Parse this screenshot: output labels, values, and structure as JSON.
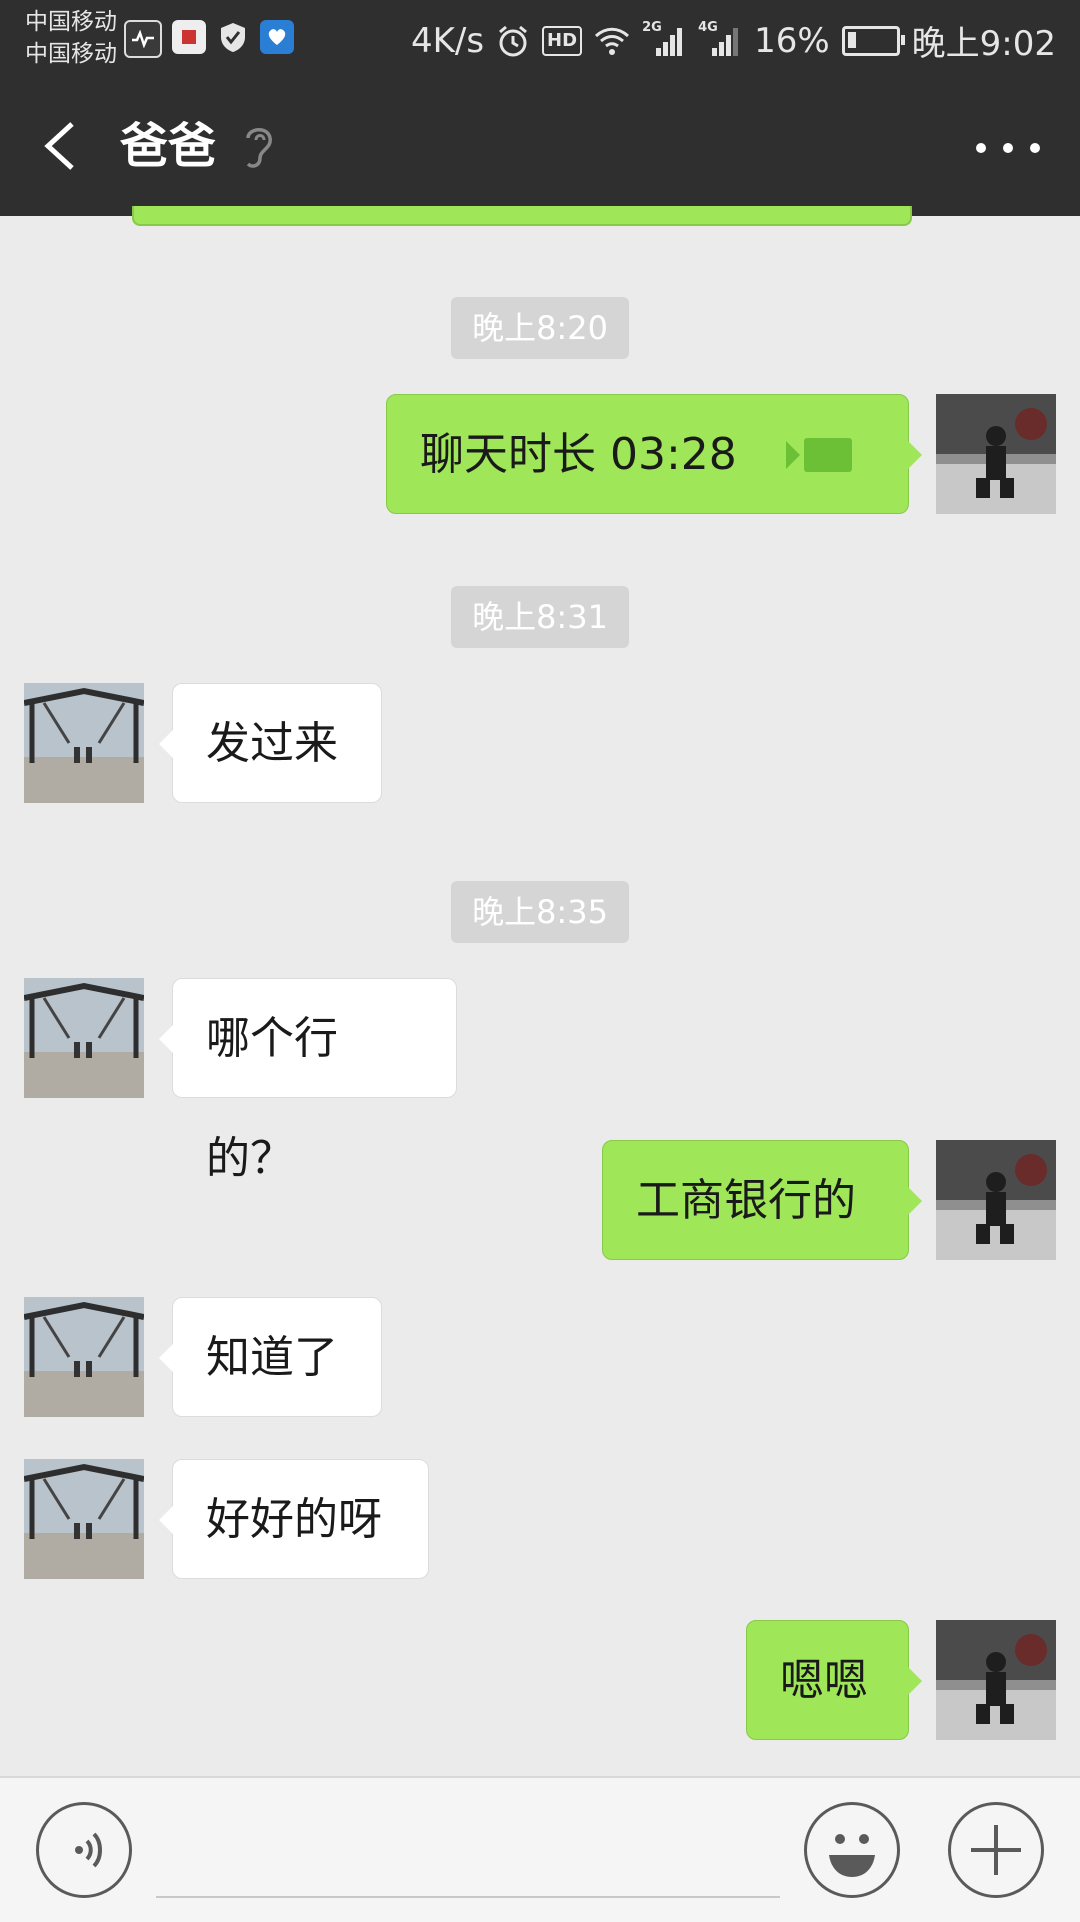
{
  "status_bar": {
    "carrier_1": "中国移动",
    "carrier_2": "中国移动",
    "network_speed": "4K/s",
    "battery": "16%",
    "time": "晚上9:02",
    "signal_1": "2G",
    "signal_2": "4G",
    "hd_badge": "HD"
  },
  "header": {
    "title": "爸爸"
  },
  "messages": [
    {
      "type": "timestamp",
      "text": "晚上8:20"
    },
    {
      "type": "call",
      "from": "me",
      "text": "聊天时长 03:28"
    },
    {
      "type": "timestamp",
      "text": "晚上8:31"
    },
    {
      "type": "text",
      "from": "dad",
      "text": "发过来"
    },
    {
      "type": "timestamp",
      "text": "晚上8:35"
    },
    {
      "type": "text",
      "from": "dad",
      "text": "哪个行的？"
    },
    {
      "type": "text",
      "from": "me",
      "text": "工商银行的"
    },
    {
      "type": "text",
      "from": "dad",
      "text": "知道了"
    },
    {
      "type": "text",
      "from": "dad",
      "text": "好好的呀"
    },
    {
      "type": "text",
      "from": "me",
      "text": "嗯嗯"
    }
  ],
  "icons": [
    "back-arrow-icon",
    "ear-icon",
    "more-icon",
    "voice-icon",
    "emoji-icon",
    "plus-icon",
    "video-call-icon"
  ],
  "colors": {
    "header_bg": "#2f2f2f",
    "chat_bg": "#ebebeb",
    "outgoing_bubble": "#9fe658",
    "incoming_bubble": "#ffffff",
    "timestamp_bg": "#d5d5d5"
  }
}
